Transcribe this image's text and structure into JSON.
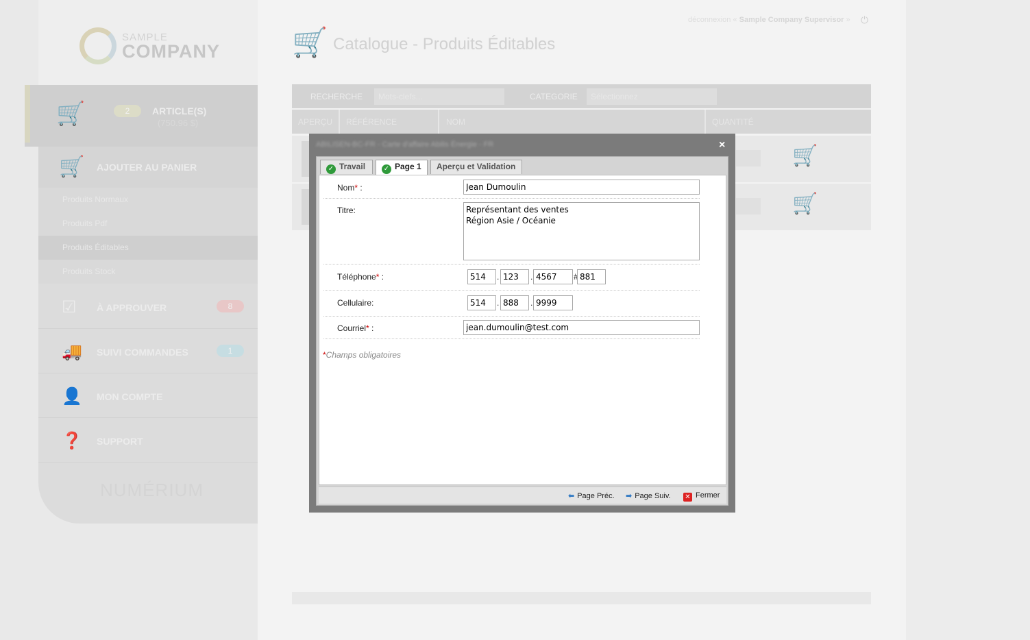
{
  "company": {
    "logo_small": "SAMPLE",
    "logo_big": "COMPANY"
  },
  "header": {
    "logout": "déconnexion",
    "user": "Sample Company Supervisor",
    "page_title": "Catalogue - Produits Éditables"
  },
  "cart": {
    "count": "2",
    "label": "ARTICLE(S)",
    "total": "(750.96 $)"
  },
  "sidebar": {
    "add_to_cart": "AJOUTER AU PANIER",
    "sub_items": [
      "Produits Normaux",
      "Produits Pdf",
      "Produits Éditables",
      "Produits Stock"
    ],
    "approve": {
      "label": "À APPROUVER",
      "badge": "8"
    },
    "orders": {
      "label": "SUIVI COMMANDES",
      "badge": "1"
    },
    "account": "MON COMPTE",
    "support": "SUPPORT",
    "footer_logo": "NUMÉRIUM"
  },
  "search": {
    "label": "RECHERCHE",
    "placeholder": "Mots-clefs...",
    "category_label": "CATEGORIE",
    "category_placeholder": "Sélectionnez"
  },
  "table": {
    "columns": [
      "APERÇU",
      "RÉFÉRENCE",
      "NOM",
      "QUANTITÉ"
    ]
  },
  "modal": {
    "title": "ABILISEN-BC-FR - Carte d'affaire Abilis Énergie - FR",
    "close_symbol": "×",
    "tabs": [
      "Travail",
      "Page 1",
      "Aperçu et Validation"
    ],
    "form": {
      "nom_label": "Nom",
      "nom_value": "Jean Dumoulin",
      "titre_label": "Titre:",
      "titre_value": "Représentant des ventes\nRégion Asie / Océanie",
      "telephone_label": "Téléphone",
      "telephone": {
        "area": "514",
        "prefix": "123",
        "line": "4567",
        "ext": "881"
      },
      "cellulaire_label": "Cellulaire:",
      "cellulaire": {
        "area": "514",
        "prefix": "888",
        "line": "9999"
      },
      "courriel_label": "Courriel",
      "courriel_value": "jean.dumoulin@test.com",
      "required_mark": "*",
      "colon": " :",
      "dot": ".",
      "hash": "#",
      "required_note": "Champs obligatoires"
    },
    "footer": {
      "prev": "Page Préc.",
      "next": "Page Suiv.",
      "close": "Fermer"
    }
  }
}
